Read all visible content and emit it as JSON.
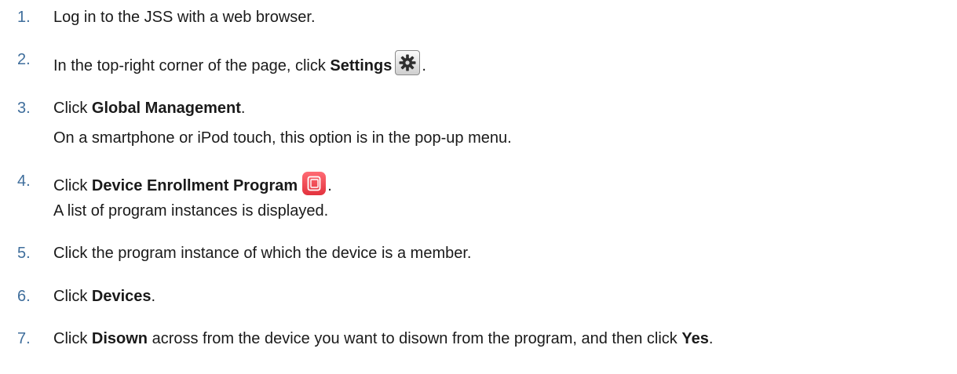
{
  "steps": [
    {
      "num": "1.",
      "pre": "Log in to the JSS with a web browser."
    },
    {
      "num": "2.",
      "pre": "In the top-right corner of the page, click ",
      "bold": "Settings",
      "icon": "gear-icon",
      "post": "."
    },
    {
      "num": "3.",
      "pre": "Click ",
      "bold": "Global Management",
      "post": ".",
      "sub": "On a smartphone or iPod touch, this option is in the pop-up menu."
    },
    {
      "num": "4.",
      "pre": "Click ",
      "bold": "Device Enrollment Program",
      "icon": "device-enrollment-icon",
      "post": ".",
      "sub": "A list of program instances is displayed."
    },
    {
      "num": "5.",
      "pre": "Click the program instance of which the device is a member."
    },
    {
      "num": "6.",
      "pre": "Click ",
      "bold": "Devices",
      "post": "."
    },
    {
      "num": "7.",
      "pre": "Click ",
      "bold": "Disown",
      "mid": " across from the device you want to disown from the program, and then click ",
      "bold2": "Yes",
      "post": "."
    }
  ],
  "colors": {
    "number": "#3f6e9c",
    "text": "#1a1a1a",
    "dep_icon": "#e8414a"
  }
}
